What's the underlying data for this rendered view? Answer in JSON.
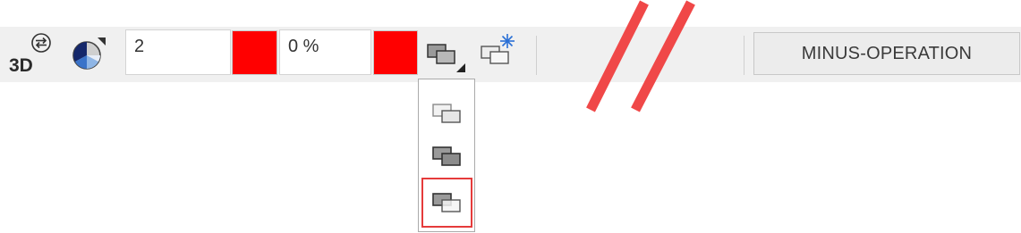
{
  "toolbar": {
    "threed_label": "3D",
    "thickness_value": "2",
    "transparency_value": "0 %",
    "minus_operation_label": "MINUS-OPERATION"
  },
  "colors": {
    "toolbar_bg": "#f0f0f0",
    "swatch_1": "#ff0000",
    "swatch_2": "#ff0000",
    "highlight_border": "#e53b3b",
    "freeze_icon_blue": "#2a6fd6",
    "break_marks": "#f04848"
  },
  "icons": {
    "threed_settings": "3d-settings-icon",
    "shading": "shading-wheel-icon",
    "layer_mode": "layer-overlap-icon",
    "freeze": "freeze-layer-icon"
  },
  "dropdown": {
    "options": [
      "layer-overlap-light",
      "layer-overlap-dark",
      "layer-overlap-dark-front"
    ],
    "selected_index": 2
  }
}
